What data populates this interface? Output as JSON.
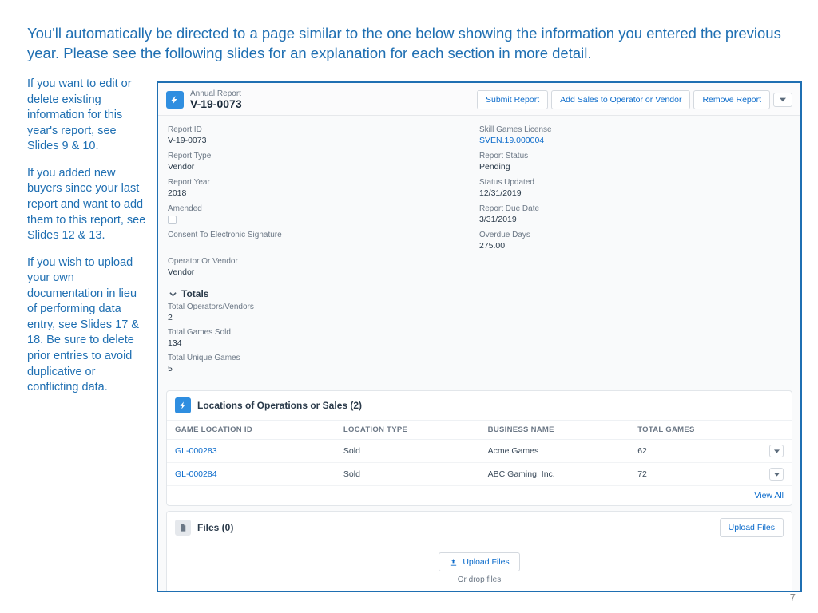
{
  "slide": {
    "title": "You'll automatically be directed to a page similar to the one below showing the information you entered the previous year.  Please see the following slides for an explanation for each section in more detail.",
    "sidebar": [
      "If you want to edit or delete existing information for this year's report, see Slides 9 & 10.",
      "If you added new buyers since your last report and want to add them to this report, see Slides 12 & 13.",
      "If you wish to upload your own documentation in lieu of performing data entry, see Slides 17 & 18. Be sure to delete prior entries to avoid duplicative or conflicting data."
    ],
    "page_number": "7"
  },
  "header": {
    "eyebrow": "Annual Report",
    "title": "V-19-0073",
    "actions": {
      "submit": "Submit Report",
      "add_sales": "Add Sales to Operator or Vendor",
      "remove": "Remove Report"
    }
  },
  "details": {
    "left": {
      "report_id": {
        "label": "Report ID",
        "value": "V-19-0073"
      },
      "report_type": {
        "label": "Report Type",
        "value": "Vendor"
      },
      "report_year": {
        "label": "Report Year",
        "value": "2018"
      },
      "amended": {
        "label": "Amended"
      },
      "consent": {
        "label": "Consent To Electronic Signature"
      },
      "operator": {
        "label": "Operator Or Vendor",
        "value": "Vendor"
      }
    },
    "right": {
      "license": {
        "label": "Skill Games License",
        "value": "SVEN.19.000004"
      },
      "status": {
        "label": "Report Status",
        "value": "Pending"
      },
      "updated": {
        "label": "Status Updated",
        "value": "12/31/2019"
      },
      "due": {
        "label": "Report Due Date",
        "value": "3/31/2019"
      },
      "overdue": {
        "label": "Overdue Days",
        "value": "275.00"
      }
    }
  },
  "totals": {
    "heading": "Totals",
    "operators": {
      "label": "Total Operators/Vendors",
      "value": "2"
    },
    "games_sold": {
      "label": "Total Games Sold",
      "value": "134"
    },
    "unique_games": {
      "label": "Total Unique Games",
      "value": "5"
    }
  },
  "locations": {
    "title": "Locations of Operations or Sales (2)",
    "columns": [
      "GAME LOCATION ID",
      "LOCATION TYPE",
      "BUSINESS NAME",
      "TOTAL GAMES"
    ],
    "rows": [
      {
        "id": "GL-000283",
        "type": "Sold",
        "name": "Acme Games",
        "games": "62"
      },
      {
        "id": "GL-000284",
        "type": "Sold",
        "name": "ABC Gaming, Inc.",
        "games": "72"
      }
    ],
    "view_all": "View All"
  },
  "files": {
    "title": "Files (0)",
    "upload_files": "Upload Files",
    "drop": "Or drop files"
  }
}
